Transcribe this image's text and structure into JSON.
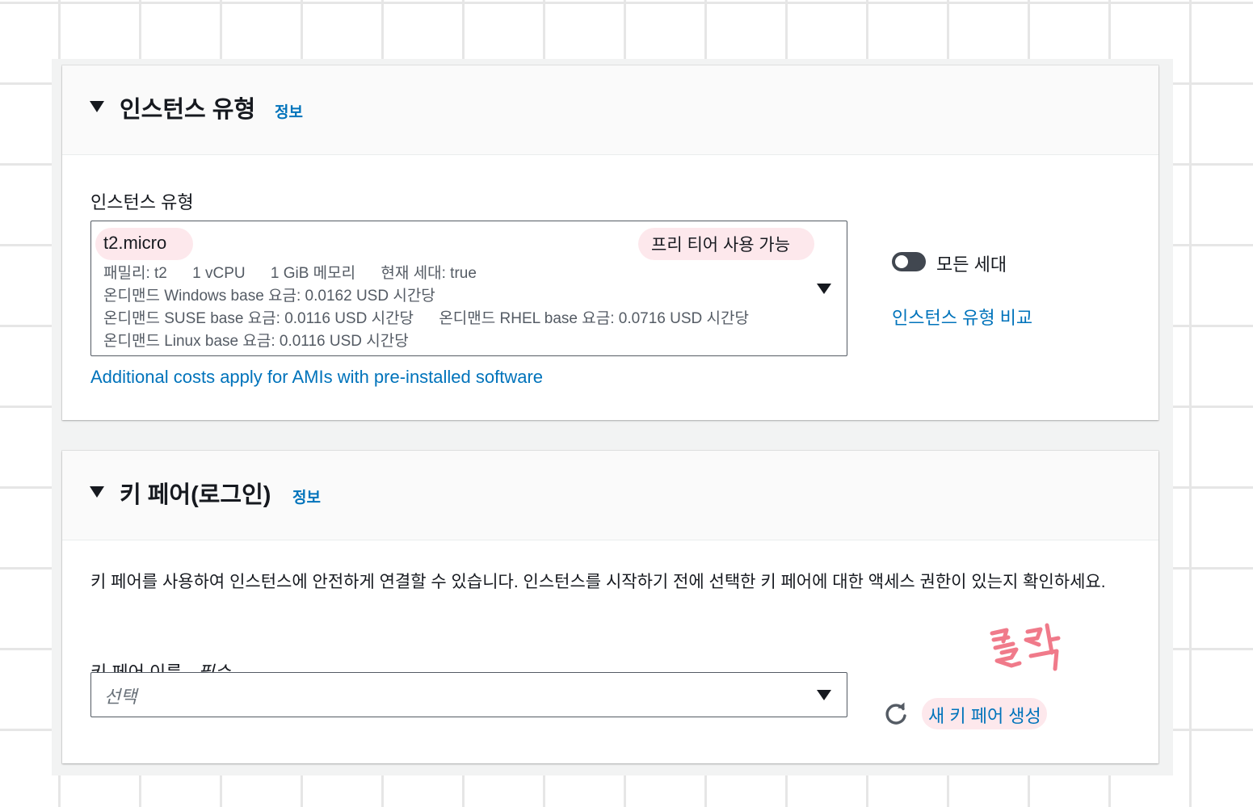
{
  "instance_type_section": {
    "title": "인스턴스 유형",
    "info_link": "정보",
    "field_label": "인스턴스 유형",
    "selected": {
      "name": "t2.micro",
      "badge": "프리 티어 사용 가능",
      "family": "패밀리: t2",
      "vcpu": "1 vCPU",
      "memory": "1 GiB 메모리",
      "generation": "현재 세대: true",
      "price_windows": "온디맨드 Windows base 요금: 0.0162 USD 시간당",
      "price_suse": "온디맨드 SUSE base 요금: 0.0116 USD 시간당",
      "price_rhel": "온디맨드 RHEL base 요금: 0.0716 USD 시간당",
      "price_linux": "온디맨드 Linux base 요금: 0.0116 USD 시간당"
    },
    "additional_costs_link": "Additional costs apply for AMIs with pre-installed software",
    "all_generations_label": "모든 세대",
    "all_generations_on": false,
    "compare_link": "인스턴스 유형 비교"
  },
  "key_pair_section": {
    "title": "키 페어(로그인)",
    "info_link": "정보",
    "description": "키 페어를 사용하여 인스턴스에 안전하게 연결할 수 있습니다. 인스턴스를 시작하기 전에 선택한 키 페어에 대한 액세스 권한이 있는지 확인하세요.",
    "field_label": "키 페어 이름 - ",
    "required_label": "필수",
    "placeholder": "선택",
    "create_link": "새 키 페어 생성",
    "refresh_icon": "refresh-icon"
  },
  "annotation": {
    "handwritten_text": "클릭",
    "color": "#f07a8a"
  },
  "colors": {
    "link": "#0073bb",
    "highlight": "#fde8ec",
    "grid": "#e6e6e6"
  }
}
